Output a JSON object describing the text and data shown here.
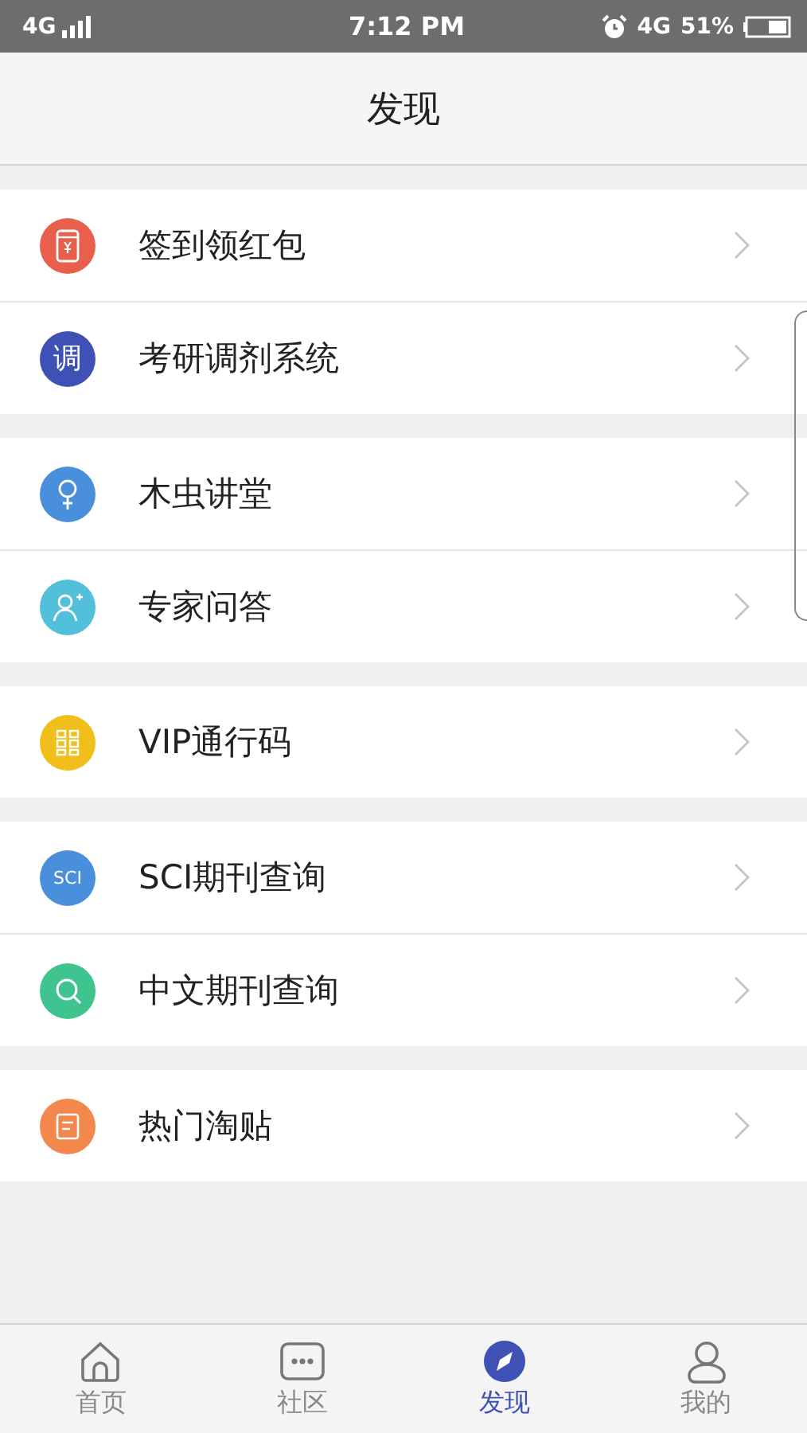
{
  "status_bar": {
    "network": "4G",
    "time": "7:12 PM",
    "data_type": "4G",
    "battery": "51%"
  },
  "header": {
    "title": "发现"
  },
  "groups": [
    {
      "items": [
        {
          "label": "签到领红包",
          "color": "#e8604c",
          "icon": {
            "kind": "envelope"
          }
        },
        {
          "label": "考研调剂系统",
          "color": "#3f51b5",
          "icon": {
            "kind": "text",
            "text": "调"
          }
        }
      ]
    },
    {
      "items": [
        {
          "label": "木虫讲堂",
          "color": "#4a8fdb",
          "icon": {
            "kind": "bulb"
          }
        },
        {
          "label": "专家问答",
          "color": "#52bfdb",
          "icon": {
            "kind": "person"
          }
        }
      ]
    },
    {
      "items": [
        {
          "label": "VIP通行码",
          "color": "#f0bf1c",
          "icon": {
            "kind": "grid"
          }
        }
      ]
    },
    {
      "items": [
        {
          "label": "SCI期刊查询",
          "color": "#4a8fdb",
          "icon": {
            "kind": "text",
            "text": "SCI"
          }
        },
        {
          "label": "中文期刊查询",
          "color": "#3fc48f",
          "icon": {
            "kind": "search"
          }
        }
      ]
    },
    {
      "items": [
        {
          "label": "热门淘贴",
          "color": "#f2884c",
          "icon": {
            "kind": "note"
          }
        }
      ]
    }
  ],
  "tabs": [
    {
      "label": "首页",
      "kind": "home",
      "selected": false
    },
    {
      "label": "社区",
      "kind": "chat",
      "selected": false
    },
    {
      "label": "发现",
      "kind": "compass",
      "selected": true
    },
    {
      "label": "我的",
      "kind": "person",
      "selected": false
    }
  ]
}
